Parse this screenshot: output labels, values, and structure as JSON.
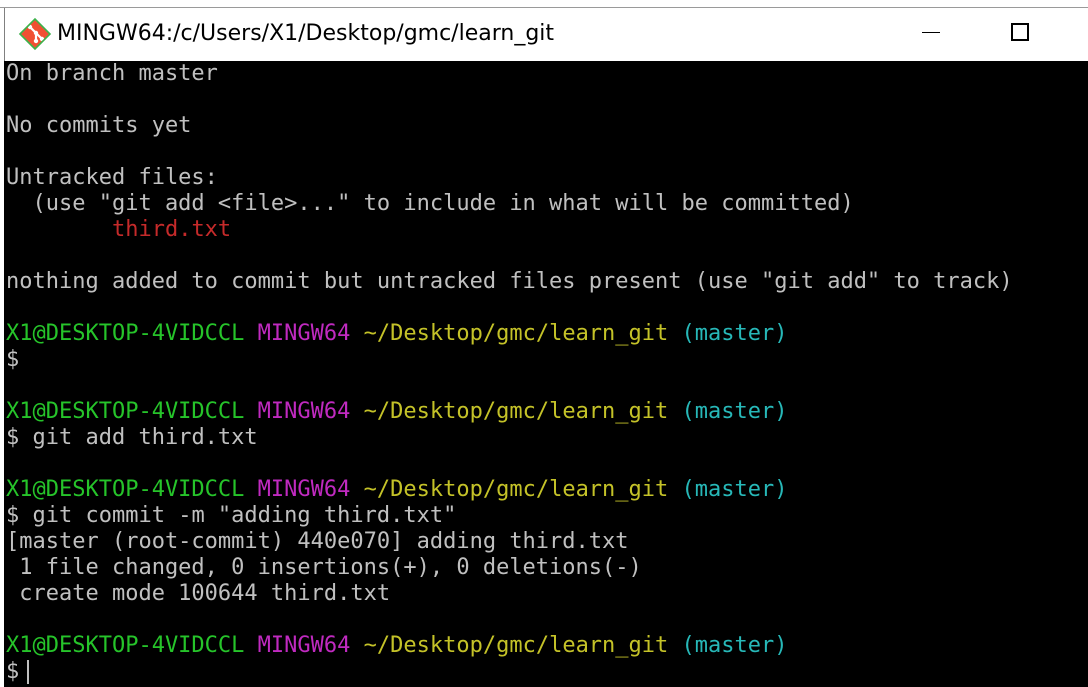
{
  "window": {
    "title": "MINGW64:/c/Users/X1/Desktop/gmc/learn_git",
    "icon": "git-icon",
    "minimize_icon": "minimize-icon",
    "maximize_icon": "maximize-icon"
  },
  "colors": {
    "background": "#000000",
    "text": "#c0c0c0",
    "user_host": "#26c42a",
    "system": "#c02ac0",
    "path": "#c4c228",
    "branch": "#27b8b8",
    "untracked_file": "#c52a2a"
  },
  "terminal": {
    "status": {
      "branch_line": "On branch master",
      "commits_line": "No commits yet",
      "untracked_header": "Untracked files:",
      "hint": "  (use \"git add <file>...\" to include in what will be committed)",
      "file_indent": "        ",
      "file": "third.txt",
      "summary": "nothing added to commit but untracked files present (use \"git add\" to track)"
    },
    "prompt": {
      "user_host": "X1@DESKTOP-4VIDCCL",
      "system": "MINGW64",
      "path": "~/Desktop/gmc/learn_git",
      "branch": "(master)",
      "symbol": "$"
    },
    "commands": {
      "first": "",
      "second": "git add third.txt",
      "third": "git commit -m \"adding third.txt\"",
      "fourth": ""
    },
    "commit_output": {
      "line1": "[master (root-commit) 440e070] adding third.txt",
      "line2": " 1 file changed, 0 insertions(+), 0 deletions(-)",
      "line3": " create mode 100644 third.txt"
    }
  }
}
